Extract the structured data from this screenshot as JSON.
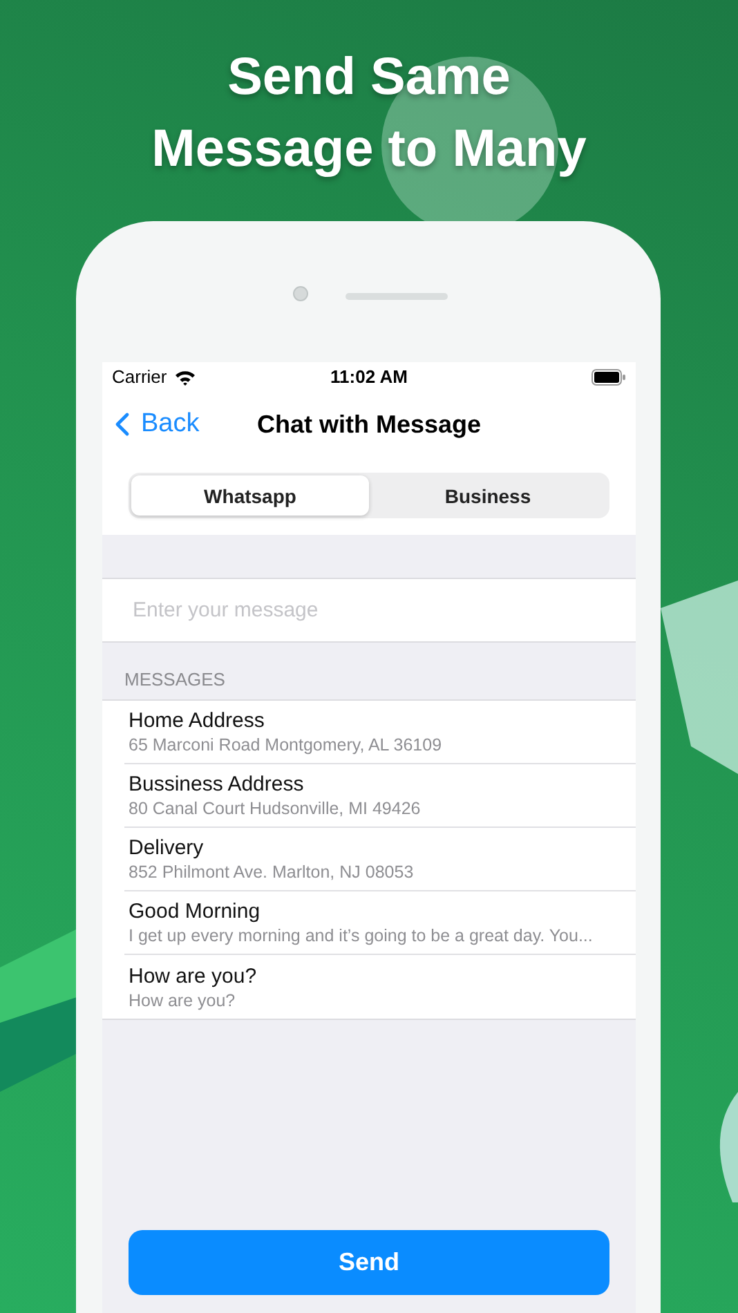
{
  "headline": [
    "Send Same",
    "Message to Many"
  ],
  "status_bar": {
    "carrier": "Carrier",
    "time": "11:02 AM"
  },
  "nav": {
    "back": "Back",
    "title": "Chat with Message"
  },
  "segments": [
    {
      "label": "Whatsapp",
      "selected": true
    },
    {
      "label": "Business",
      "selected": false
    }
  ],
  "message_field": {
    "placeholder": "Enter your message"
  },
  "section_header": "MESSAGES",
  "messages": [
    {
      "title": "Home Address",
      "subtitle": "65 Marconi Road Montgomery, AL 36109"
    },
    {
      "title": "Bussiness Address",
      "subtitle": "80 Canal Court Hudsonville, MI 49426"
    },
    {
      "title": "Delivery",
      "subtitle": "852 Philmont Ave. Marlton, NJ 08053"
    },
    {
      "title": "Good Morning",
      "subtitle": "I get up every morning and it’s going to be a great day. You..."
    },
    {
      "title": "How are you?",
      "subtitle": "How are you?"
    }
  ],
  "send_button": "Send"
}
